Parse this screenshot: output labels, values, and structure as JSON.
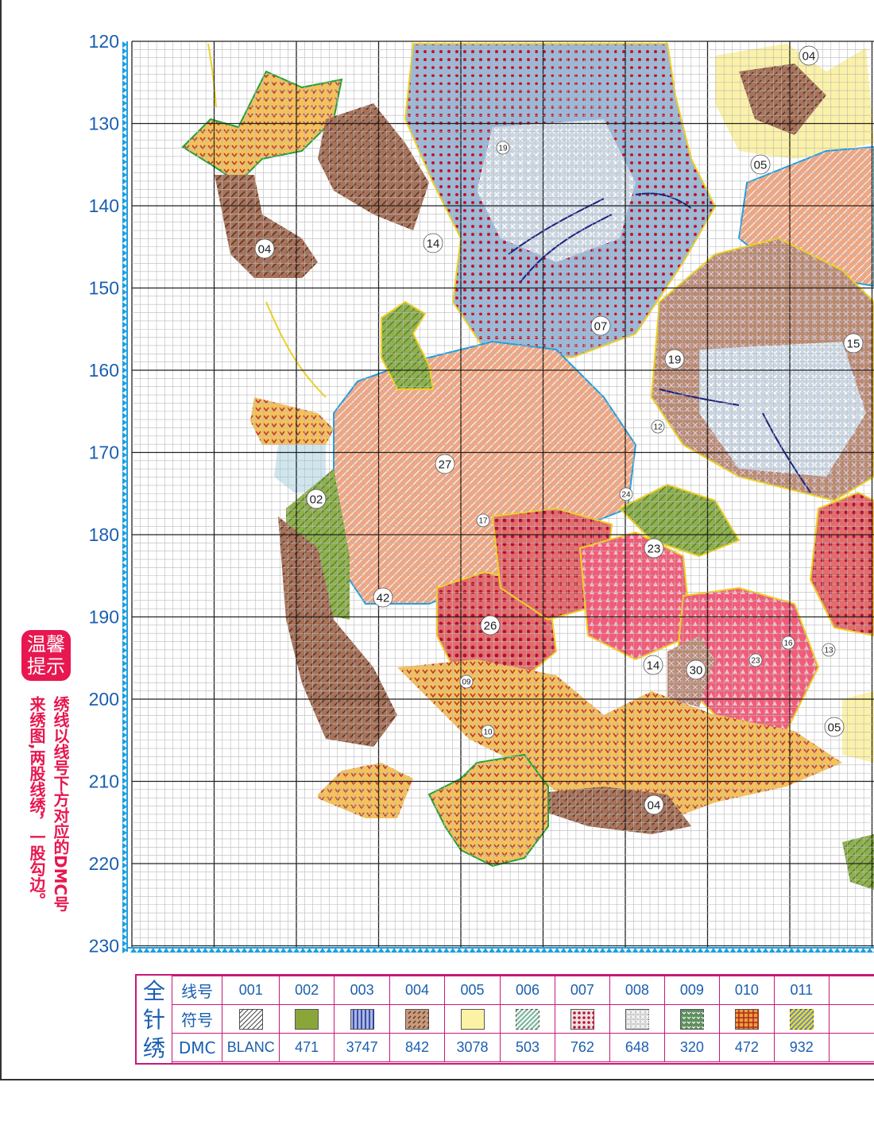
{
  "axis": {
    "labels": [
      "120",
      "130",
      "140",
      "150",
      "160",
      "170",
      "180",
      "190",
      "200",
      "210",
      "220",
      "230"
    ],
    "accent_color": "#1e9fe0",
    "label_color": "#1a5fb0"
  },
  "region_numbers": [
    "04",
    "05",
    "14",
    "04",
    "19",
    "07",
    "19",
    "15",
    "12",
    "27",
    "02",
    "17",
    "24",
    "23",
    "42",
    "26",
    "14",
    "30",
    "23",
    "16",
    "13",
    "05",
    "09",
    "10",
    "04"
  ],
  "tip": {
    "badge": "温馨提示",
    "line1": "绣线以线号下方对应的DMC号",
    "line2": "来绣图,两股线绣，一股勾边。"
  },
  "legend": {
    "title": "全针绣",
    "row_heads": [
      "线号",
      "符号",
      "DMC"
    ],
    "columns": [
      {
        "no": "001",
        "dmc": "BLANC",
        "symbol": "diagonal-hatch-icon",
        "color": "#ffffff"
      },
      {
        "no": "002",
        "dmc": "471",
        "symbol": "solid-square-icon",
        "color": "#8aa63a"
      },
      {
        "no": "003",
        "dmc": "3747",
        "symbol": "vertical-stripe-icon",
        "color": "#a9b6e6"
      },
      {
        "no": "004",
        "dmc": "842",
        "symbol": "brown-dots-icon",
        "color": "#c79a7c"
      },
      {
        "no": "005",
        "dmc": "3078",
        "symbol": "solid-square-icon",
        "color": "#fbf3a3"
      },
      {
        "no": "006",
        "dmc": "503",
        "symbol": "green-hatch-icon",
        "color": "#7fb7a0"
      },
      {
        "no": "007",
        "dmc": "762",
        "symbol": "red-dots-icon",
        "color": "#e9e4e4"
      },
      {
        "no": "008",
        "dmc": "648",
        "symbol": "cross-pattern-icon",
        "color": "#cfcfcf"
      },
      {
        "no": "009",
        "dmc": "320",
        "symbol": "chevron-pattern-icon",
        "color": "#5e8f5e"
      },
      {
        "no": "010",
        "dmc": "472",
        "symbol": "plus-grid-icon",
        "color": "#e8a13c"
      },
      {
        "no": "011",
        "dmc": "932",
        "symbol": "yellow-hatch-icon",
        "color": "#6e8cc7"
      }
    ]
  }
}
